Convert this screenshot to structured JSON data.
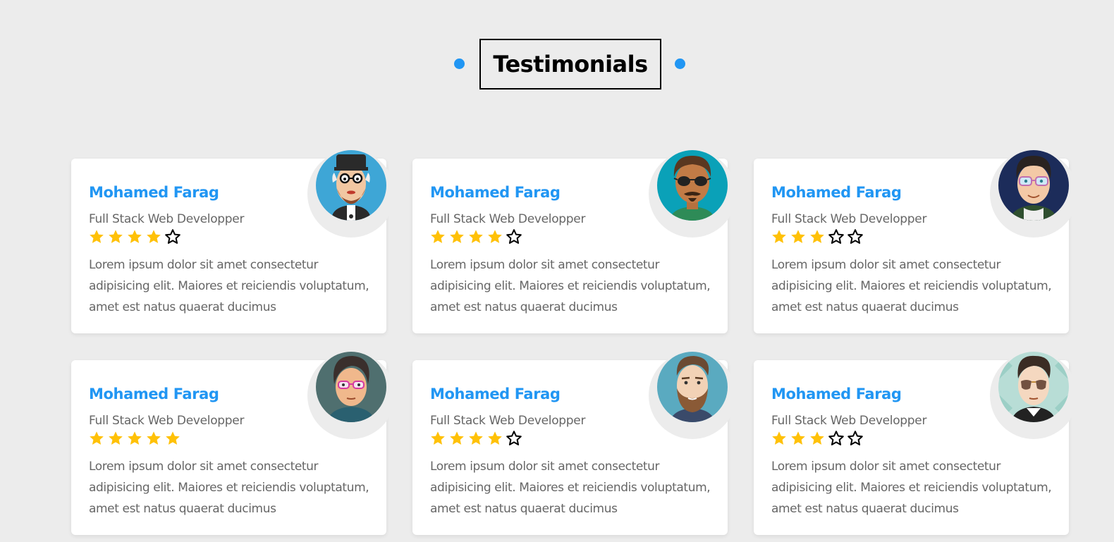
{
  "section": {
    "title": "Testimonials",
    "accent_color": "#2196f3"
  },
  "testimonials": [
    {
      "name": "Mohamed Farag",
      "role": "Full Stack Web Developper",
      "rating": 4,
      "max_rating": 5,
      "text": "Lorem ipsum dolor sit amet consectetur adipisicing elit. Maiores et reiciendis voluptatum, amet est natus quaerat ducimus",
      "avatar_icon": "hipster-avatar-icon"
    },
    {
      "name": "Mohamed Farag",
      "role": "Full Stack Web Developper",
      "rating": 4,
      "max_rating": 5,
      "text": "Lorem ipsum dolor sit amet consectetur adipisicing elit. Maiores et reiciendis voluptatum, amet est natus quaerat ducimus",
      "avatar_icon": "sunglasses-avatar-icon"
    },
    {
      "name": "Mohamed Farag",
      "role": "Full Stack Web Developper",
      "rating": 3,
      "max_rating": 5,
      "text": "Lorem ipsum dolor sit amet consectetur adipisicing elit. Maiores et reiciendis voluptatum, amet est natus quaerat ducimus",
      "avatar_icon": "glasses-avatar-icon"
    },
    {
      "name": "Mohamed Farag",
      "role": "Full Stack Web Developper",
      "rating": 5,
      "max_rating": 5,
      "text": "Lorem ipsum dolor sit amet consectetur adipisicing elit. Maiores et reiciendis voluptatum, amet est natus quaerat ducimus",
      "avatar_icon": "pink-glasses-avatar-icon"
    },
    {
      "name": "Mohamed Farag",
      "role": "Full Stack Web Developper",
      "rating": 4,
      "max_rating": 5,
      "text": "Lorem ipsum dolor sit amet consectetur adipisicing elit. Maiores et reiciendis voluptatum, amet est natus quaerat ducimus",
      "avatar_icon": "bearded-avatar-icon"
    },
    {
      "name": "Mohamed Farag",
      "role": "Full Stack Web Developper",
      "rating": 3,
      "max_rating": 5,
      "text": "Lorem ipsum dolor sit amet consectetur adipisicing elit. Maiores et reiciendis voluptatum, amet est natus quaerat ducimus",
      "avatar_icon": "aviator-avatar-icon"
    }
  ],
  "colors": {
    "star_filled": "#ffc107",
    "star_empty_outline": "#000000",
    "name": "#2196f3",
    "body_text": "#666666",
    "background": "#ececec"
  }
}
